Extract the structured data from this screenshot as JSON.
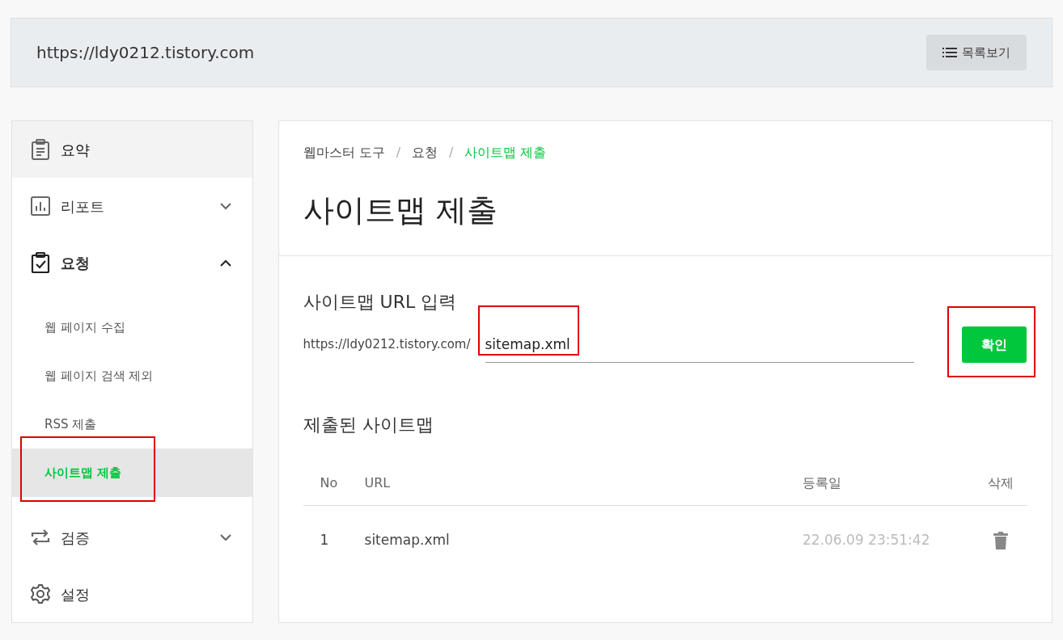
{
  "header": {
    "url": "https://ldy0212.tistory.com",
    "list_button": {
      "label": "목록보기"
    }
  },
  "sidebar": {
    "items": [
      {
        "kind": "menu",
        "label": "요약",
        "selected": true
      },
      {
        "kind": "menu",
        "label": "리포트",
        "selected": false,
        "expanded": false
      },
      {
        "kind": "menu",
        "label": "요청",
        "selected": false,
        "expanded": true,
        "children": [
          {
            "label": "웹 페이지 수집",
            "selected": false,
            "highlighted": false
          },
          {
            "label": "웹 페이지 검색 제외",
            "selected": false,
            "highlighted": false
          },
          {
            "label": "RSS 제출",
            "selected": false,
            "highlighted": false
          },
          {
            "label": "사이트맵 제출",
            "selected": true,
            "highlighted": true
          }
        ]
      },
      {
        "kind": "menu",
        "label": "검증",
        "selected": false,
        "expanded": false
      },
      {
        "kind": "menu",
        "label": "설정",
        "selected": false
      }
    ]
  },
  "breadcrumb": [
    {
      "label": "웹마스터 도구",
      "selected": false
    },
    {
      "label": "/",
      "kind": "sep"
    },
    {
      "label": "요청",
      "selected": false
    },
    {
      "label": "/",
      "kind": "sep"
    },
    {
      "label": "사이트맵 제출",
      "selected": true
    }
  ],
  "page_title": "사이트맵 제출",
  "url_form": {
    "title": "사이트맵 URL 입력",
    "prefix": "https://ldy0212.tistory.com/",
    "value": "sitemap.xml",
    "value_highlighted": true,
    "submit": {
      "label": "확인",
      "highlighted": true
    }
  },
  "submitted": {
    "title": "제출된 사이트맵",
    "columns": [
      "No",
      "URL",
      "등록일",
      "삭제"
    ],
    "rows": [
      {
        "no": "1",
        "url": "sitemap.xml",
        "date": "22.06.09 23:51:42"
      }
    ]
  }
}
